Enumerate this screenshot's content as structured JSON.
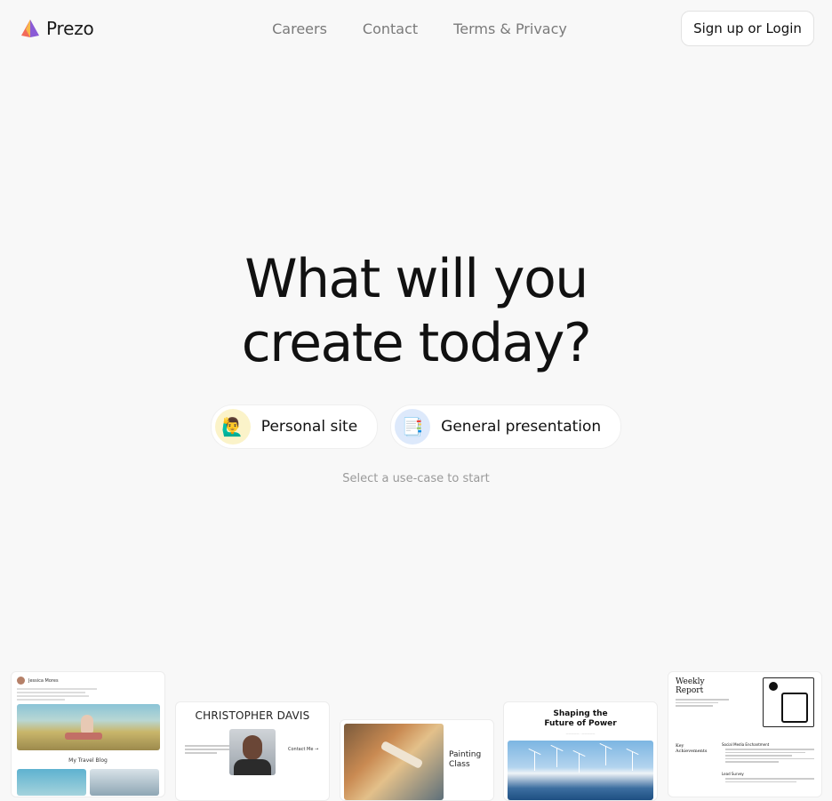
{
  "brand": {
    "name": "Prezo"
  },
  "nav": {
    "items": [
      "Careers",
      "Contact",
      "Terms & Privacy"
    ]
  },
  "header": {
    "login_label": "Sign up or Login"
  },
  "hero": {
    "line1": "What will you",
    "line2": "create today?"
  },
  "use_cases": [
    {
      "label": "Personal site",
      "icon": "person-raising-hand-emoji",
      "glyph": "🙋‍♂️"
    },
    {
      "label": "General presentation",
      "icon": "document-emoji",
      "glyph": "📑"
    }
  ],
  "hint": "Select a use-case to start",
  "templates": {
    "blog": {
      "author": "Jessica Mores",
      "title": "My Travel Blog"
    },
    "portfolio": {
      "name": "CHRISTOPHER DAVIS",
      "cta": "Contact Me →"
    },
    "class": {
      "title": "Painting Class"
    },
    "energy": {
      "title": "Shaping the Future of Power"
    },
    "report": {
      "title": "Weekly Report",
      "section": "Key Achievements",
      "item1": "Social Media Enchantment",
      "item2": "Lead Survey"
    }
  },
  "colors": {
    "background": "#f8f8f8",
    "text": "#111111",
    "muted": "#7a7a7a"
  }
}
